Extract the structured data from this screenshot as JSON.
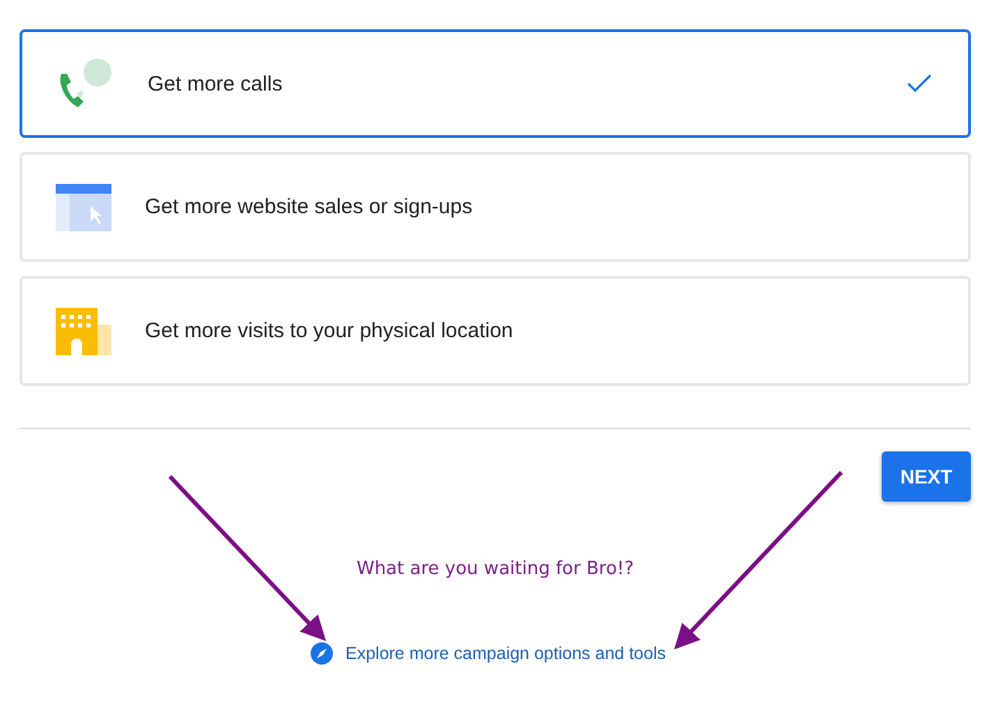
{
  "options": [
    {
      "kind": "calls",
      "label": "Get more calls",
      "selected": true
    },
    {
      "kind": "website",
      "label": "Get more website sales or sign-ups",
      "selected": false
    },
    {
      "kind": "visits",
      "label": "Get more visits to your physical location",
      "selected": false
    }
  ],
  "next_button": "NEXT",
  "annotation": "What are you waiting for Bro!?",
  "explore_link": "Explore more campaign options and tools"
}
